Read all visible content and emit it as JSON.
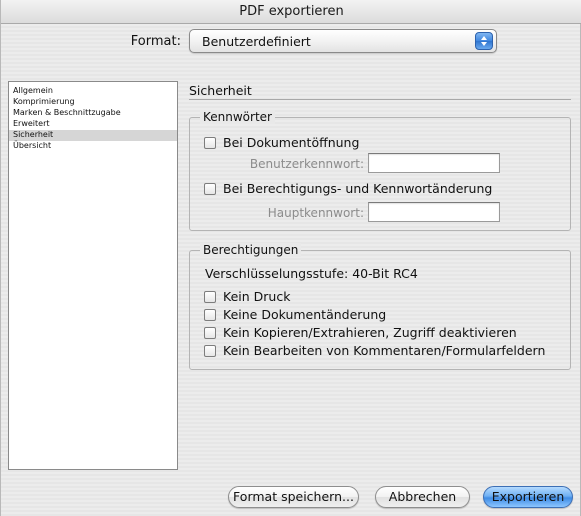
{
  "window": {
    "title": "PDF exportieren"
  },
  "format": {
    "label": "Format:",
    "value": "Benutzerdefiniert"
  },
  "sidebar": {
    "items": [
      {
        "label": "Allgemein"
      },
      {
        "label": "Komprimierung"
      },
      {
        "label": "Marken & Beschnittzugabe"
      },
      {
        "label": "Erweitert"
      },
      {
        "label": "Sicherheit",
        "selected": true
      },
      {
        "label": "Übersicht"
      }
    ]
  },
  "security": {
    "title": "Sicherheit",
    "passwords": {
      "legend": "Kennwörter",
      "doc_open_label": "Bei Dokumentöffnung",
      "user_password_label": "Benutzerkennwort:",
      "user_password_value": "",
      "perm_change_label": "Bei Berechtigungs- und Kennwortänderung",
      "master_password_label": "Hauptkennwort:",
      "master_password_value": ""
    },
    "permissions": {
      "legend": "Berechtigungen",
      "encryption_text": "Verschlüsselungsstufe: 40-Bit RC4",
      "options": [
        "Kein Druck",
        "Keine Dokumentänderung",
        "Kein Kopieren/Extrahieren, Zugriff deaktivieren",
        "Kein Bearbeiten von Kommentaren/Formularfeldern"
      ]
    }
  },
  "buttons": {
    "save_format": "Format speichern...",
    "cancel": "Abbrechen",
    "export": "Exportieren"
  }
}
